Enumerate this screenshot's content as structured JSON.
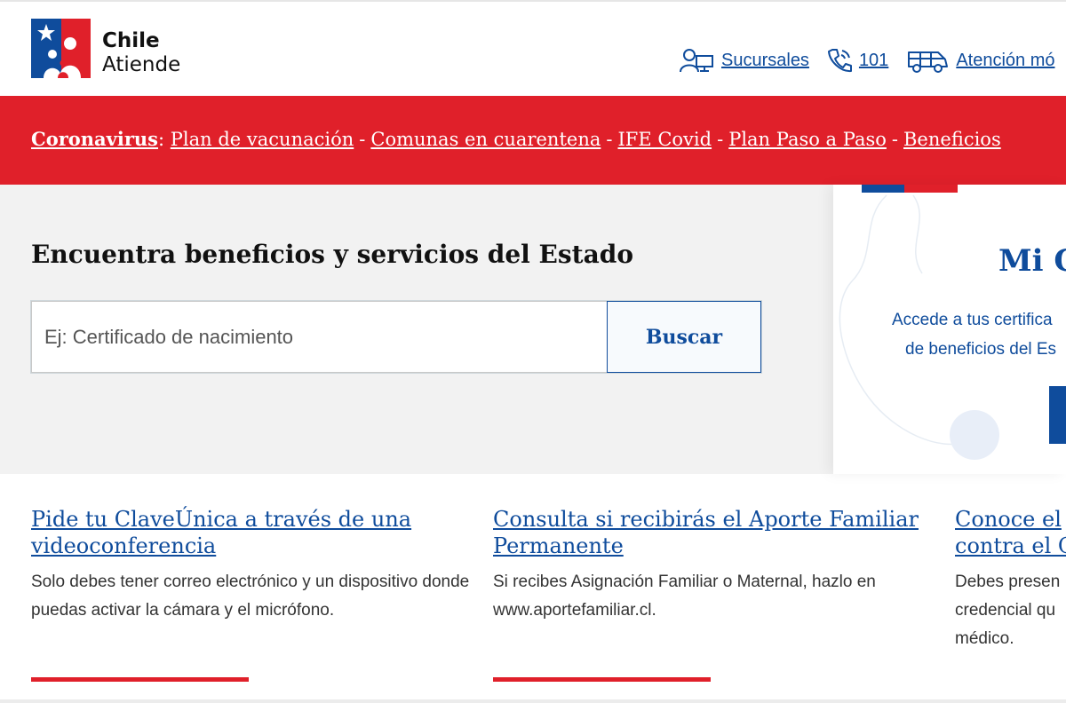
{
  "header": {
    "logo": {
      "line1": "Chile",
      "line2": "Atiende"
    },
    "links": [
      {
        "label": "Sucursales",
        "icon": "branch-office-icon"
      },
      {
        "label": "101",
        "icon": "phone-icon"
      },
      {
        "label": "Atención mó",
        "icon": "van-icon"
      }
    ]
  },
  "banner": {
    "lead": "Coronavirus",
    "colon": ":",
    "links": [
      "Plan de vacunación",
      "Comunas en cuarentena",
      "IFE Covid",
      "Plan Paso a Paso",
      "Beneficios"
    ],
    "separator": "-"
  },
  "search": {
    "title": "Encuentra beneficios y servicios del Estado",
    "placeholder": "Ej: Certificado de nacimiento",
    "button_label": "Buscar"
  },
  "mi_card": {
    "title": "Mi C",
    "desc_line1": "Accede a tus certifica",
    "desc_line2": "de beneficios del Es"
  },
  "news": [
    {
      "title": "Pide tu ClaveÚnica a través de una videoconferencia",
      "description": "Solo debes tener correo electrónico y un dispositivo donde puedas activar la cámara y el micrófono."
    },
    {
      "title": "Consulta si recibirás el Aporte Familiar Permanente",
      "description": "Si recibes Asignación Familiar o Maternal, hazlo en www.aportefamiliar.cl."
    },
    {
      "title": "Conoce el contra el C",
      "description": "Debes presen credencial qu médico."
    }
  ],
  "colors": {
    "brand_blue": "#0f4c9c",
    "brand_red": "#e0202a",
    "search_bg": "#f2f2f2"
  }
}
